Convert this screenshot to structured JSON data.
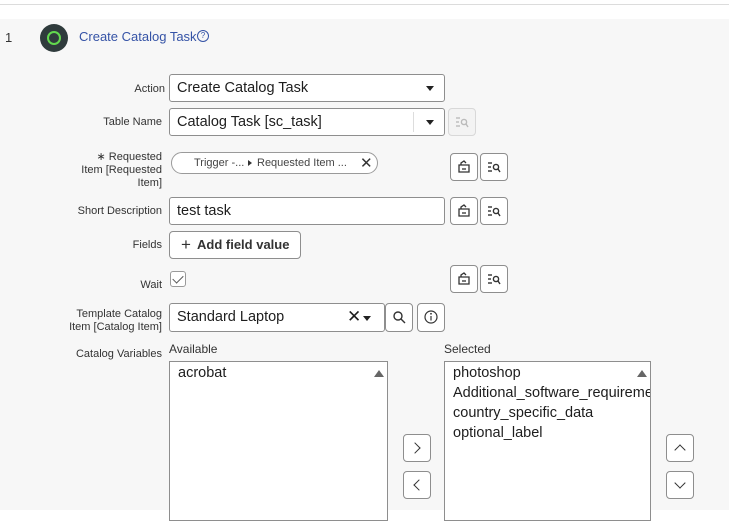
{
  "step": {
    "number": "1",
    "title": "Create Catalog Task",
    "help_icon": "?"
  },
  "fields": {
    "action": {
      "label": "Action",
      "value": "Create Catalog Task"
    },
    "table_name": {
      "label": "Table Name",
      "value": "Catalog Task [sc_task]"
    },
    "requested_item": {
      "required_mark": "∗",
      "label_line1": "Requested",
      "label_line2": "Item [Requested",
      "label_line3": "Item]",
      "pill_part1": "Trigger -...",
      "pill_part2": "Requested Item ...",
      "pill_remove": "✕"
    },
    "short_description": {
      "label": "Short Description",
      "value": "test task"
    },
    "fields_row": {
      "label": "Fields",
      "add_button_plus": "+",
      "add_button": "Add field value"
    },
    "wait": {
      "label": "Wait",
      "checked": true
    },
    "template_catalog_item": {
      "label_line1": "Template Catalog",
      "label_line2": "Item [Catalog Item]",
      "value": "Standard Laptop",
      "clear": "✕"
    },
    "catalog_variables": {
      "label": "Catalog Variables",
      "available_header": "Available",
      "selected_header": "Selected",
      "available": [
        "acrobat"
      ],
      "selected": [
        "photoshop",
        "Additional_software_requirements",
        "country_specific_data",
        "optional_label"
      ]
    }
  },
  "colors": {
    "link": "#3553a6",
    "brand_dark": "#2f3b3c",
    "brand_green": "#62d84e"
  }
}
